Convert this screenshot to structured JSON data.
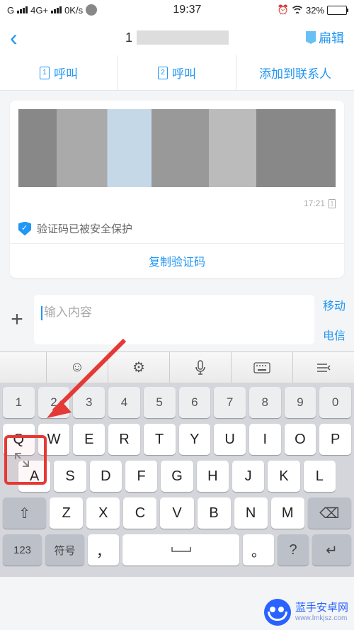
{
  "status": {
    "network": "G",
    "signal1": "ılıl",
    "net_type": "4G+",
    "signal2": "ılıl",
    "speed": "0K/s",
    "time": "19:37",
    "alarm": "⏰",
    "wifi": "📶",
    "battery_pct": "32%"
  },
  "nav": {
    "title_prefix": "1",
    "edit": "扁辑"
  },
  "actions": {
    "call1": {
      "sim": "1",
      "label": "呼叫"
    },
    "call2": {
      "sim": "2",
      "label": "呼叫"
    },
    "add_contact": "添加到联系人"
  },
  "message": {
    "time": "17:21",
    "sim": "1",
    "verify_text": "验证码已被安全保护",
    "copy_label": "复制验证码"
  },
  "input": {
    "placeholder": "输入内容",
    "sim1": "移动",
    "sim2": "电信"
  },
  "keyboard": {
    "nums": [
      "1",
      "2",
      "3",
      "4",
      "5",
      "6",
      "7",
      "8",
      "9",
      "0"
    ],
    "row1": [
      "Q",
      "W",
      "E",
      "R",
      "T",
      "Y",
      "U",
      "I",
      "O",
      "P"
    ],
    "row2": [
      "A",
      "S",
      "D",
      "F",
      "G",
      "H",
      "J",
      "K",
      "L"
    ],
    "row3": [
      "Z",
      "X",
      "C",
      "V",
      "B",
      "N",
      "M"
    ],
    "shift": "⇧",
    "backspace": "⌫",
    "num_switch": "123",
    "symbol": "符号",
    "comma": "，",
    "space": "⌣",
    "period": "。",
    "enter": "↵",
    "question": "?"
  },
  "watermark": {
    "name": "蓝手安卓网",
    "url": "www.lmkjsz.com"
  }
}
